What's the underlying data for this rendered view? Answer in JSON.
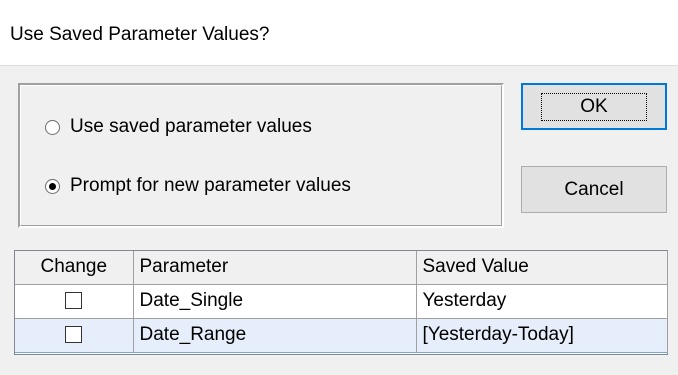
{
  "window": {
    "title": "Use Saved Parameter Values?"
  },
  "options": [
    {
      "label": "Use saved parameter values",
      "checked": false
    },
    {
      "label": "Prompt for new parameter values",
      "checked": true
    }
  ],
  "buttons": {
    "ok": "OK",
    "cancel": "Cancel"
  },
  "table": {
    "headers": [
      "Change",
      "Parameter",
      "Saved Value"
    ],
    "rows": [
      {
        "change": false,
        "parameter": "Date_Single",
        "value": "Yesterday"
      },
      {
        "change": false,
        "parameter": "Date_Range",
        "value": "[Yesterday-Today]"
      }
    ]
  }
}
